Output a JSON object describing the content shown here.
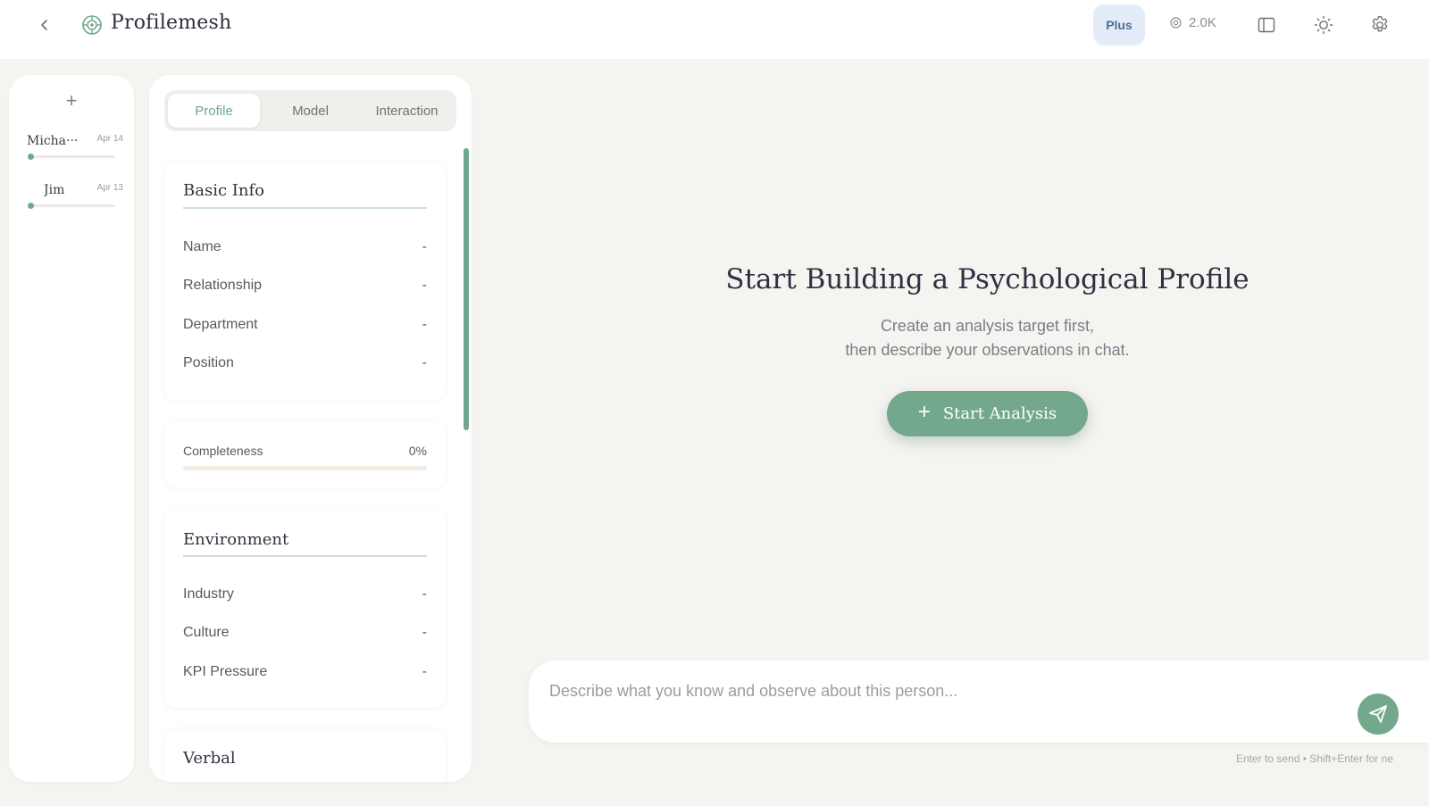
{
  "header": {
    "app_title": "Profilemesh",
    "plan_badge": "Plus",
    "credits": "2.0K",
    "icons": [
      "back-icon",
      "logo-icon",
      "credits-icon",
      "panel-toggle-icon",
      "theme-sun-icon",
      "gear-icon"
    ]
  },
  "rail": {
    "add_label": "+",
    "targets": [
      {
        "name": "Micha···",
        "date": "Apr 14"
      },
      {
        "name": "Jim",
        "date": "Apr 13"
      }
    ]
  },
  "panel": {
    "tabs": [
      "Profile",
      "Model",
      "Interaction"
    ],
    "active_tab": "Profile",
    "basic_info": {
      "title": "Basic Info",
      "fields": [
        {
          "label": "Name",
          "value": "-"
        },
        {
          "label": "Relationship",
          "value": "-"
        },
        {
          "label": "Department",
          "value": "-"
        },
        {
          "label": "Position",
          "value": "-"
        }
      ]
    },
    "completeness": {
      "label": "Completeness",
      "value": "0%",
      "fraction": 0
    },
    "environment": {
      "title": "Environment",
      "fields": [
        {
          "label": "Industry",
          "value": "-"
        },
        {
          "label": "Culture",
          "value": "-"
        },
        {
          "label": "KPI Pressure",
          "value": "-"
        }
      ]
    },
    "verbal": {
      "title": "Verbal"
    }
  },
  "main": {
    "title": "Start Building a Psychological Profile",
    "subtitle_line1": "Create an analysis target first,",
    "subtitle_line2": "then describe your observations in chat.",
    "start_button": "Start Analysis",
    "composer_placeholder": "Describe what you know and observe about this person...",
    "hint": "Enter to send  •  Shift+Enter for ne"
  },
  "colors": {
    "accent": "#74a88d",
    "background": "#f6f4f1",
    "badge_bg": "#e3ecf8",
    "badge_text": "#4e6d99"
  }
}
